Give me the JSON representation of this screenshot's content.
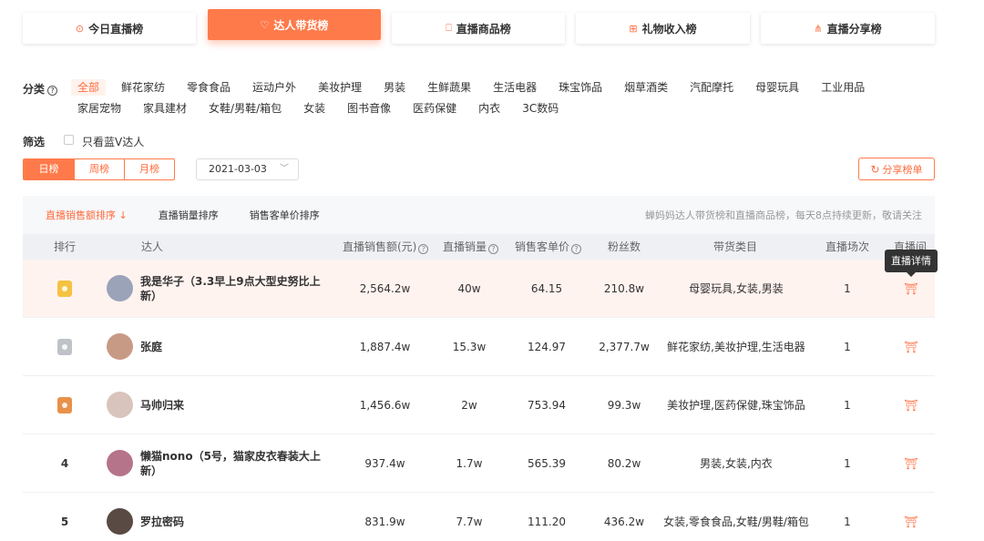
{
  "top_tabs": [
    {
      "label": "今日直播榜",
      "icon": "clock-icon"
    },
    {
      "label": "达人带货榜",
      "icon": "heart-icon"
    },
    {
      "label": "直播商品榜",
      "icon": "bag-icon"
    },
    {
      "label": "礼物收入榜",
      "icon": "gift-icon"
    },
    {
      "label": "直播分享榜",
      "icon": "share-icon"
    }
  ],
  "active_top_tab": "达人带货榜",
  "category": {
    "label": "分类",
    "row1": [
      "全部",
      "鲜花家纺",
      "零食食品",
      "运动户外",
      "美妆护理",
      "男装",
      "生鲜蔬果",
      "生活电器",
      "珠宝饰品",
      "烟草酒类",
      "汽配摩托",
      "母婴玩具",
      "工业用品"
    ],
    "row2": [
      "家居宠物",
      "家具建材",
      "女鞋/男鞋/箱包",
      "女装",
      "图书音像",
      "医药保健",
      "内衣",
      "3C数码"
    ],
    "active": "全部"
  },
  "filter": {
    "label": "筛选",
    "checkbox_label": "只看蓝V达人",
    "checked": false
  },
  "period": {
    "options": [
      "日榜",
      "周榜",
      "月榜"
    ],
    "active": "日榜"
  },
  "date": {
    "value": "2021-03-03"
  },
  "share_button": {
    "label": "分享榜单"
  },
  "sort_bar": {
    "options": [
      "直播销售额排序",
      "直播销量排序",
      "销售客单价排序"
    ],
    "active": "直播销售额排序",
    "note": "蝉妈妈达人带货榜和直播商品榜，每天8点持续更新，敬请关注"
  },
  "table": {
    "headers": {
      "rank": "排行",
      "talent": "达人",
      "sales_amount": "直播销售额(元)",
      "sales_volume": "直播销量",
      "unit_price": "销售客单价",
      "fans": "粉丝数",
      "categories": "带货类目",
      "sessions": "直播场次",
      "live": "直播间"
    },
    "rows": [
      {
        "rank": "",
        "medal": "gold",
        "name": "我是华子（3.3早上9点大型史努比上新）",
        "sales_amount": "2,564.2w",
        "sales_volume": "40w",
        "unit_price": "64.15",
        "fans": "210.8w",
        "categories": "母婴玩具,女装,男装",
        "sessions": "1",
        "avatar_color": "#9aa3b8"
      },
      {
        "rank": "",
        "medal": "silver",
        "name": "张庭",
        "sales_amount": "1,887.4w",
        "sales_volume": "15.3w",
        "unit_price": "124.97",
        "fans": "2,377.7w",
        "categories": "鲜花家纺,美妆护理,生活电器",
        "sessions": "1",
        "avatar_color": "#c79a86"
      },
      {
        "rank": "",
        "medal": "bronze",
        "name": "马帅归来",
        "sales_amount": "1,456.6w",
        "sales_volume": "2w",
        "unit_price": "753.94",
        "fans": "99.3w",
        "categories": "美妆护理,医药保健,珠宝饰品",
        "sessions": "1",
        "avatar_color": "#d8c4bc"
      },
      {
        "rank": "4",
        "medal": "",
        "name": "懒猫nono（5号，猫家皮衣春装大上新）",
        "sales_amount": "937.4w",
        "sales_volume": "1.7w",
        "unit_price": "565.39",
        "fans": "80.2w",
        "categories": "男装,女装,内衣",
        "sessions": "1",
        "avatar_color": "#b5748a"
      },
      {
        "rank": "5",
        "medal": "",
        "name": "罗拉密码",
        "sales_amount": "831.9w",
        "sales_volume": "7.7w",
        "unit_price": "111.20",
        "fans": "436.2w",
        "categories": "女装,零食食品,女鞋/男鞋/箱包",
        "sessions": "1",
        "avatar_color": "#5a4a44"
      }
    ]
  },
  "tooltip": {
    "text": "直播详情"
  },
  "colors": {
    "accent": "#ff7a4a",
    "gold": "#f5c242",
    "silver": "#bfc3c8",
    "bronze": "#e8914a"
  }
}
